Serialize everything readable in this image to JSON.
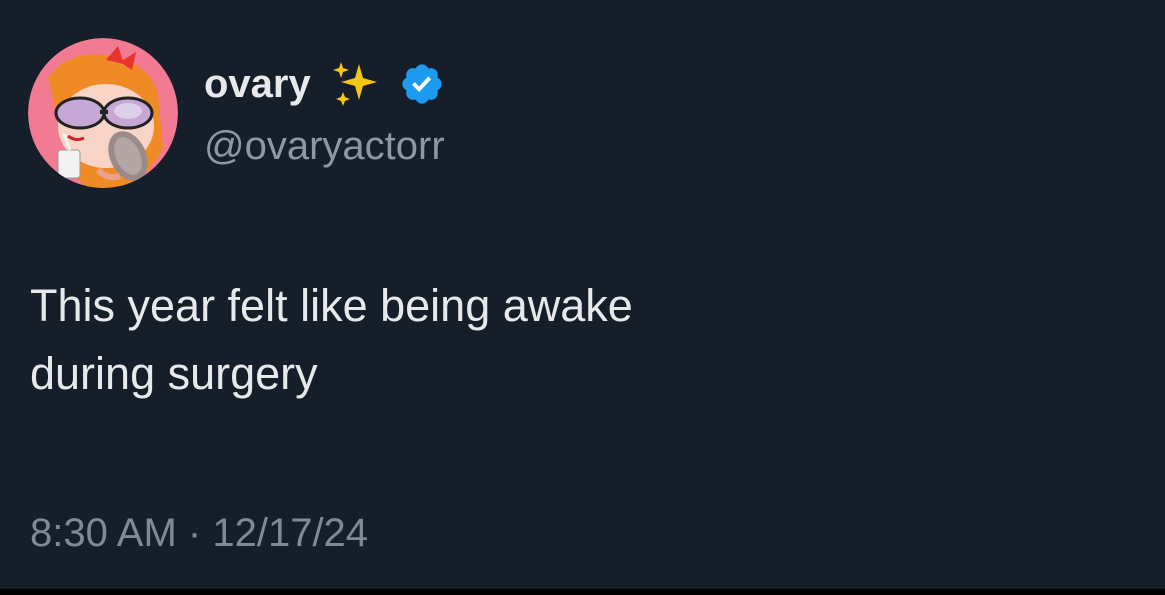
{
  "tweet": {
    "display_name": "ovary",
    "handle": "@ovaryactorr",
    "text_lines": [
      "This year felt like being awake",
      "during surgery"
    ],
    "time": "8:30 AM",
    "separator": "·",
    "date": "12/17/24",
    "avatar_icon": "powerpuff-girl-avatar-icon",
    "badge_icon": "verified-badge-icon",
    "emoji_icon": "sparkles-icon"
  },
  "colors": {
    "background": "#151e29",
    "primary_text": "#e7e9ea",
    "secondary_text": "#8b98a5",
    "verified": "#1d9bf0",
    "sparkles": "#f5c518",
    "avatar_bg": "#f27a93"
  }
}
